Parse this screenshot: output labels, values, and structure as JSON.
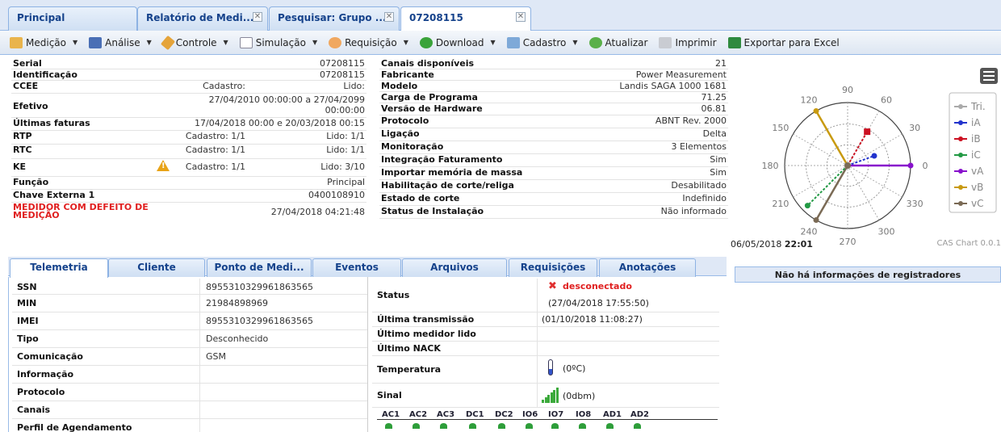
{
  "tabs": [
    {
      "label": "Principal"
    },
    {
      "label": "Relatório de Medi..."
    },
    {
      "label": "Pesquisar: Grupo ..."
    },
    {
      "label": "07208115"
    }
  ],
  "toolbar": {
    "items": [
      "Medição",
      "Análise",
      "Controle",
      "Simulação",
      "Requisição",
      "Download",
      "Cadastro",
      "Atualizar",
      "Imprimir",
      "Exportar para Excel"
    ]
  },
  "left": {
    "serial_k": "Serial",
    "serial_v": "07208115",
    "ident_k": "Identificação",
    "ident_v": "07208115",
    "ccee_k": "CCEE",
    "ccee_a": "Cadastro:",
    "ccee_b": "Lido:",
    "efetivo_k": "Efetivo",
    "efetivo_v1": "27/04/2010 00:00:00 a 27/04/2099",
    "efetivo_v2": "00:00:00",
    "faturas_k": "Últimas faturas",
    "faturas_v": "17/04/2018 00:00 e 20/03/2018 00:15",
    "rtp_k": "RTP",
    "rtp_a": "Cadastro: 1/1",
    "rtp_b": "Lido: 1/1",
    "rtc_k": "RTC",
    "rtc_a": "Cadastro: 1/1",
    "rtc_b": "Lido: 1/1",
    "ke_k": "KE",
    "ke_a": "Cadastro: 1/1",
    "ke_b": "Lido: 3/10",
    "funcao_k": "Função",
    "funcao_v": "Principal",
    "chave_k": "Chave Externa 1",
    "chave_v": "0400108910",
    "defeito_k1": "MEDIDOR COM DEFEITO DE",
    "defeito_k2": "MEDIÇÃO",
    "defeito_v": "27/04/2018 04:21:48"
  },
  "right": [
    {
      "k": "Canais disponíveis",
      "v": "21"
    },
    {
      "k": "Fabricante",
      "v": "Power Measurement"
    },
    {
      "k": "Modelo",
      "v": "Landis SAGA 1000 1681"
    },
    {
      "k": "Carga de Programa",
      "v": "71.25"
    },
    {
      "k": "Versão de Hardware",
      "v": "06.81"
    },
    {
      "k": "Protocolo",
      "v": "ABNT Rev. 2000"
    },
    {
      "k": "Ligação",
      "v": "Delta"
    },
    {
      "k": "Monitoração",
      "v": "3 Elementos"
    },
    {
      "k": "Integração Faturamento",
      "v": "Sim"
    },
    {
      "k": "Importar memória de massa",
      "v": "Sim"
    },
    {
      "k": "Habilitação de corte/religa",
      "v": "Desabilitado"
    },
    {
      "k": "Estado de corte",
      "v": "Indefinido"
    },
    {
      "k": "Status de Instalação",
      "v": "Não informado"
    }
  ],
  "chart": {
    "date": "06/05/2018",
    "time": "22:01",
    "credit": "CAS Chart 0.0.1",
    "angles": [
      "90",
      "60",
      "30",
      "0",
      "330",
      "300",
      "270",
      "240",
      "210",
      "180",
      "150",
      "120"
    ],
    "legend": [
      "Tri.",
      "iA",
      "iB",
      "iC",
      "vA",
      "vB",
      "vC"
    ],
    "colors": {
      "iA": "#2233cc",
      "iB": "#cc1122",
      "iC": "#229944",
      "vA": "#8811cc",
      "vB": "#c89a10",
      "vC": "#7a6a55",
      "tri": "#aaaaaa"
    }
  },
  "chart_data": {
    "type": "polar",
    "phasors": [
      {
        "name": "vA",
        "angle": 0,
        "mag": 1
      },
      {
        "name": "vB",
        "angle": 120,
        "mag": 1
      },
      {
        "name": "vC",
        "angle": 240,
        "mag": 1
      },
      {
        "name": "iA",
        "angle": 20,
        "mag": 0.45
      },
      {
        "name": "iB",
        "angle": 60,
        "mag": 0.62
      },
      {
        "name": "iC",
        "angle": 225,
        "mag": 0.9
      }
    ]
  },
  "btabs": [
    "Telemetria",
    "Cliente",
    "Ponto de Medi...",
    "Eventos",
    "Arquivos",
    "Requisições",
    "Anotações"
  ],
  "tele": {
    "rows": [
      {
        "k": "SSN",
        "v": "8955310329961863565"
      },
      {
        "k": "MIN",
        "v": "21984898969"
      },
      {
        "k": "IMEI",
        "v": "8955310329961863565"
      },
      {
        "k": "Tipo",
        "v": "Desconhecido"
      },
      {
        "k": "Comunicação",
        "v": "GSM"
      },
      {
        "k": "Informação",
        "v": ""
      },
      {
        "k": "Protocolo",
        "v": ""
      },
      {
        "k": "Canais",
        "v": ""
      },
      {
        "k": "Perfil de Agendamento",
        "v": ""
      }
    ],
    "status_k": "Status",
    "status_v": "desconectado",
    "status_date": "(27/04/2018 17:55:50)",
    "ult_tx_k": "Última transmissão",
    "ult_tx_v": "(01/10/2018 11:08:27)",
    "ult_med_k": "Último medidor lido",
    "ult_nack_k": "Último NACK",
    "temp_k": "Temperatura",
    "temp_v": "(0ºC)",
    "sinal_k": "Sinal",
    "sinal_v": "(0dbm)",
    "channels": [
      "AC1",
      "AC2",
      "AC3",
      "DC1",
      "DC2",
      "IO6",
      "IO7",
      "IO8",
      "AD1",
      "AD2"
    ]
  },
  "registers": "Não há informações de registradores"
}
